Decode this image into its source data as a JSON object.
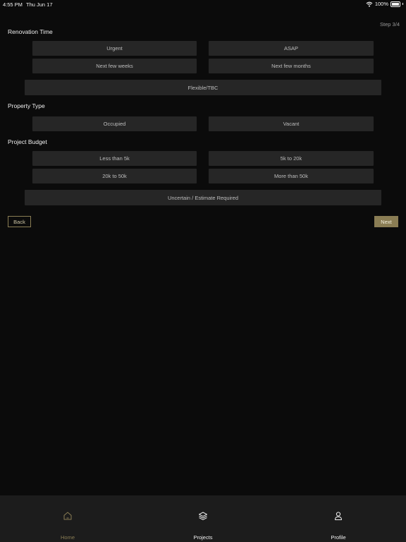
{
  "status_bar": {
    "time": "4:55 PM",
    "date": "Thu Jun 17",
    "battery": "100%"
  },
  "step": "Step 3/4",
  "renovation_time": {
    "title": "Renovation Time",
    "options": [
      "Urgent",
      "ASAP",
      "Next few weeks",
      "Next few months"
    ],
    "wide_option": "Flexible/TBC"
  },
  "property_type": {
    "title": "Property Type",
    "options": [
      "Occupied",
      "Vacant"
    ]
  },
  "project_budget": {
    "title": "Project Budget",
    "options": [
      "Less than 5k",
      "5k to 20k",
      "20k to 50k",
      "More than 50k"
    ],
    "wide_option": "Uncertain / Estimate Required"
  },
  "nav": {
    "back": "Back",
    "next": "Next"
  },
  "tabs": [
    {
      "label": "Home",
      "icon": "home-icon"
    },
    {
      "label": "Projects",
      "icon": "layers-icon"
    },
    {
      "label": "Profile",
      "icon": "person-icon"
    }
  ],
  "colors": {
    "accent": "#8a7d54",
    "background": "#0b0b0b",
    "option_bg": "#262626",
    "tabbar_bg": "#1c1c1c"
  }
}
